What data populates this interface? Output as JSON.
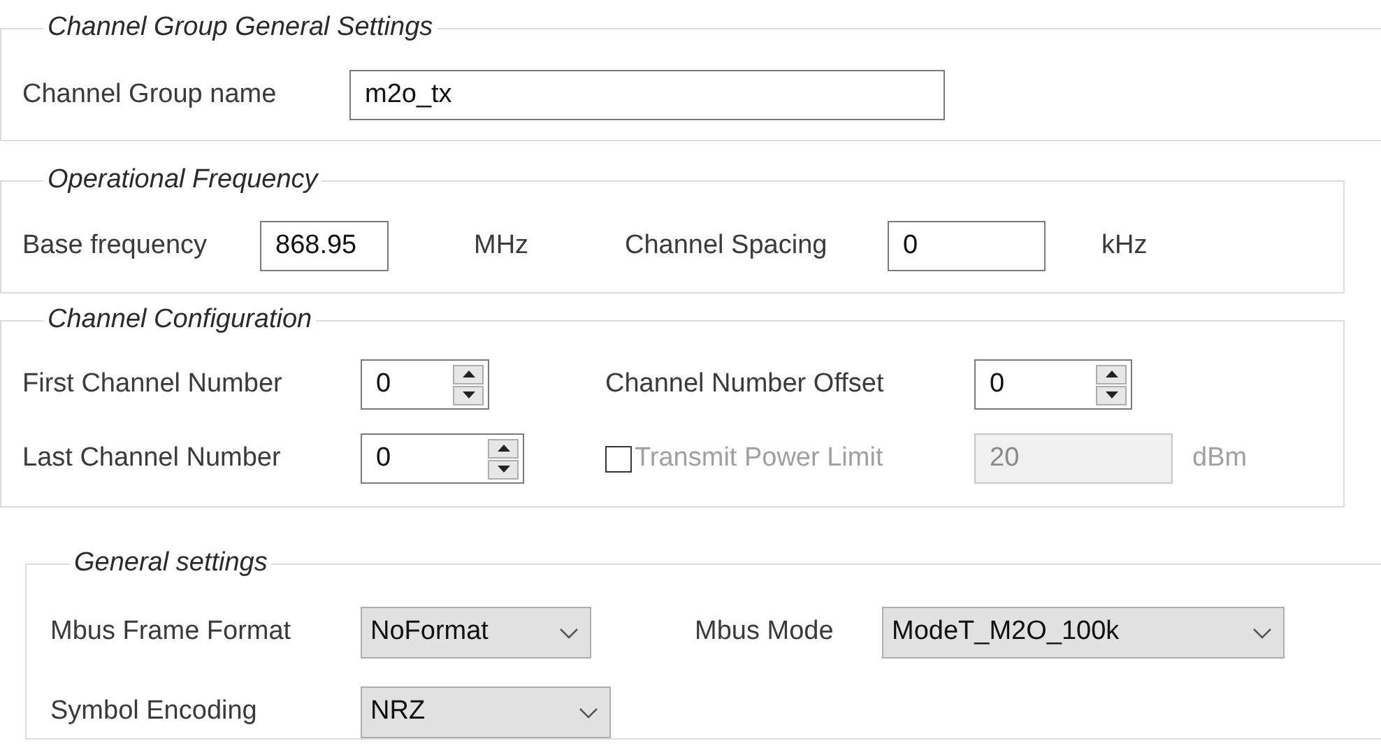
{
  "groups": [
    {
      "title": "Channel Group General Settings",
      "rows": [
        [
          {
            "kind": "text",
            "label": "Channel Group name",
            "value": "m2o_tx",
            "disabled": false
          }
        ]
      ]
    },
    {
      "title": "Operational Frequency",
      "rows": [
        [
          {
            "kind": "text",
            "label": "Base frequency",
            "value": "868.95",
            "unit": "MHz",
            "disabled": false
          },
          {
            "kind": "text",
            "label": "Channel Spacing",
            "value": "0",
            "unit": "kHz",
            "disabled": false
          }
        ]
      ]
    },
    {
      "title": "Channel Configuration",
      "rows": [
        [
          {
            "kind": "spinner",
            "label": "First Channel Number",
            "value": "0",
            "disabled": false
          },
          {
            "kind": "spinner",
            "label": "Channel Number Offset",
            "value": "0",
            "disabled": false
          }
        ],
        [
          {
            "kind": "spinner",
            "label": "Last Channel Number",
            "value": "0",
            "disabled": false
          },
          {
            "kind": "checkbox_text",
            "label": "Transmit Power Limit",
            "checked": false,
            "value": "20",
            "unit": "dBm",
            "disabled": true
          }
        ]
      ]
    },
    {
      "title": "General settings",
      "rows": [
        [
          {
            "kind": "select",
            "label": "Mbus Frame Format",
            "value": "NoFormat",
            "disabled": false
          },
          {
            "kind": "select",
            "label": "Mbus Mode",
            "value": "ModeT_M2O_100k",
            "disabled": false
          }
        ],
        [
          {
            "kind": "select",
            "label": "Symbol Encoding",
            "value": "NRZ",
            "disabled": false
          }
        ]
      ]
    }
  ]
}
